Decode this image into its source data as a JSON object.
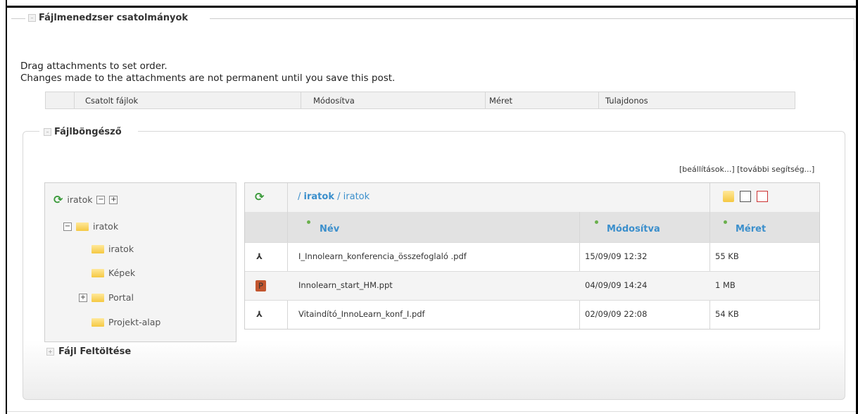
{
  "attachments_section": {
    "legend": "Fájlmenedzser csatolmányok",
    "info_line1": "Drag attachments to set order.",
    "info_line2": "Changes made to the attachments are not permanent until you save this post.",
    "columns": [
      "Csatolt fájlok",
      "Módosítva",
      "Méret",
      "Tulajdonos"
    ]
  },
  "file_browser": {
    "legend": "Fájlböngésző",
    "settings_link": "[beállítások...]",
    "help_link": "[további segítség...]",
    "tree": {
      "root": "iratok",
      "items": [
        {
          "label": "iratok"
        },
        {
          "label": "iratok"
        },
        {
          "label": "Képek"
        },
        {
          "label": "Portal"
        },
        {
          "label": "Projekt-alap"
        }
      ]
    },
    "path": {
      "sep1": "/",
      "bold": "iratok",
      "sep2": "/",
      "rest": "iratok"
    },
    "columns": {
      "name": "Név",
      "modified": "Módosítva",
      "size": "Méret"
    },
    "files": [
      {
        "name": "I_Innolearn_konferencia_összefoglaló .pdf",
        "modified": "15/09/09 12:32",
        "size": "55 KB",
        "icon": "pdf-icon"
      },
      {
        "name": "Innolearn_start_HM.ppt",
        "modified": "04/09/09 14:24",
        "size": "1 MB",
        "icon": "ppt-icon"
      },
      {
        "name": "Vitaindító_InnoLearn_konf_I.pdf",
        "modified": "02/09/09 22:08",
        "size": "54 KB",
        "icon": "pdf-icon"
      }
    ]
  },
  "upload_section": {
    "legend": "Fájl Feltöltése"
  },
  "colors": {
    "accent": "#3b8fcc",
    "folder": "#f5c842",
    "pdf": "#dd3333"
  }
}
